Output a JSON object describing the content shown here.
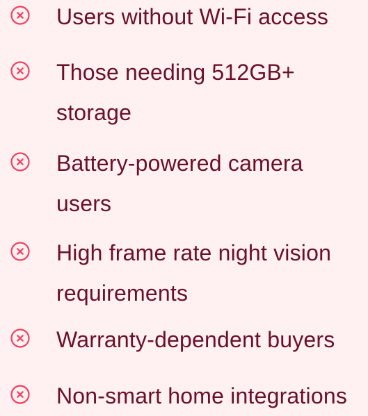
{
  "cons": {
    "items": [
      {
        "label": "Users without Wi-Fi access",
        "icon": "x-circle-icon"
      },
      {
        "label": "Those needing 512GB+ storage",
        "icon": "x-circle-icon"
      },
      {
        "label": "Battery-powered camera users",
        "icon": "x-circle-icon"
      },
      {
        "label": "High frame rate night vision requirements",
        "icon": "x-circle-icon"
      },
      {
        "label": "Warranty-dependent buyers",
        "icon": "x-circle-icon"
      },
      {
        "label": "Non-smart home integrations",
        "icon": "x-circle-icon"
      }
    ]
  },
  "colors": {
    "background": "#fff1f2",
    "text": "#6a1028",
    "icon": "#f43f5e"
  }
}
